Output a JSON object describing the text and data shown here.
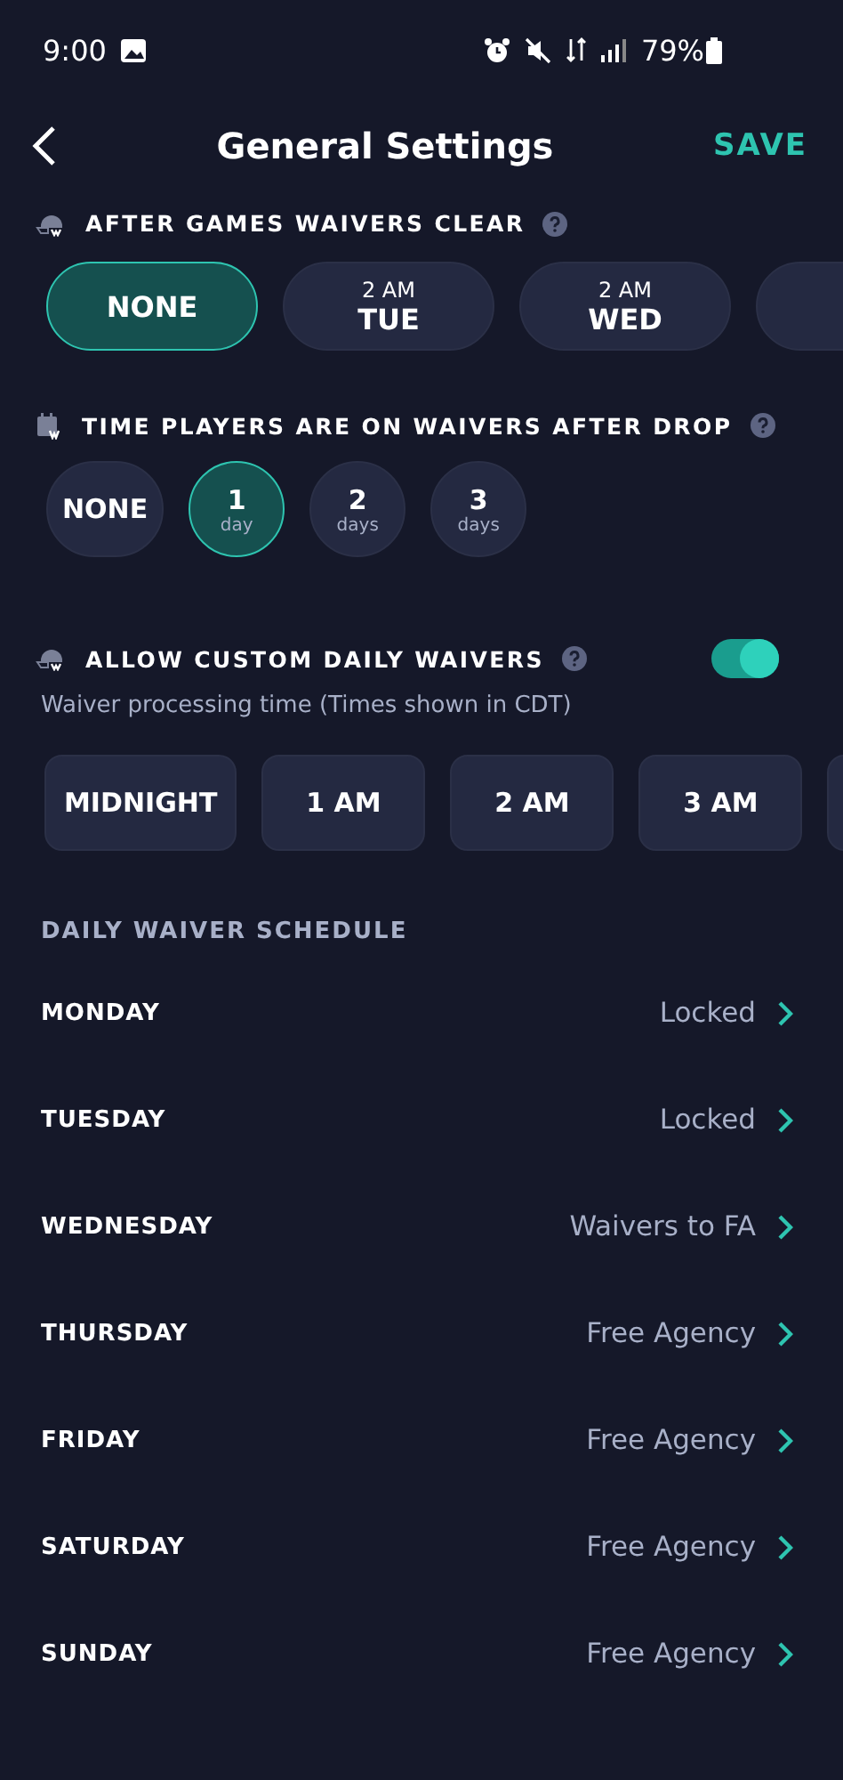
{
  "status_bar": {
    "time": "9:00",
    "battery": "79%"
  },
  "header": {
    "title": "General Settings",
    "action": "SAVE"
  },
  "waivers_clear": {
    "label": "AFTER GAMES WAIVERS CLEAR",
    "options": [
      {
        "main": "NONE",
        "selected": true
      },
      {
        "top": "2 AM",
        "main": "TUE",
        "selected": false
      },
      {
        "top": "2 AM",
        "main": "WED",
        "selected": false
      },
      {
        "selected": false
      }
    ]
  },
  "waiver_duration": {
    "label": "TIME PLAYERS ARE ON WAIVERS AFTER DROP",
    "options": [
      {
        "main": "NONE",
        "selected": false
      },
      {
        "main": "1",
        "unit": "day",
        "selected": true
      },
      {
        "main": "2",
        "unit": "days",
        "selected": false
      },
      {
        "main": "3",
        "unit": "days",
        "selected": false
      }
    ]
  },
  "custom_daily": {
    "label": "ALLOW CUSTOM DAILY WAIVERS",
    "on": true,
    "note": "Waiver processing time (Times shown in CDT)",
    "times": [
      {
        "label": "MIDNIGHT",
        "selected": false
      },
      {
        "label": "1 AM",
        "selected": false
      },
      {
        "label": "2 AM",
        "selected": false
      },
      {
        "label": "3 AM",
        "selected": false
      },
      {
        "selected": false
      }
    ]
  },
  "schedule": {
    "title": "DAILY WAIVER SCHEDULE",
    "rows": [
      {
        "day": "MONDAY",
        "value": "Locked"
      },
      {
        "day": "TUESDAY",
        "value": "Locked"
      },
      {
        "day": "WEDNESDAY",
        "value": "Waivers to FA"
      },
      {
        "day": "THURSDAY",
        "value": "Free Agency"
      },
      {
        "day": "FRIDAY",
        "value": "Free Agency"
      },
      {
        "day": "SATURDAY",
        "value": "Free Agency"
      },
      {
        "day": "SUNDAY",
        "value": "Free Agency"
      }
    ]
  }
}
